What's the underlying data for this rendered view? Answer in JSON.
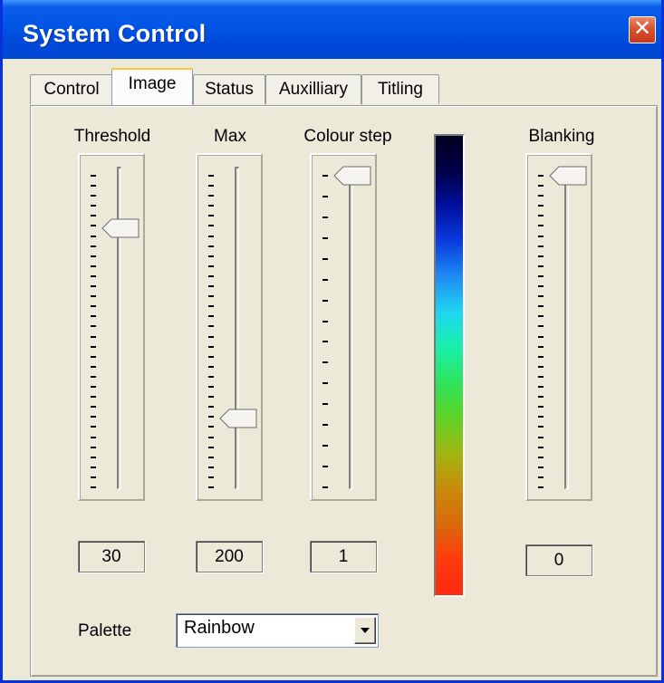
{
  "window": {
    "title": "System Control",
    "close_glyph": "✕"
  },
  "tabs": [
    {
      "label": "Control",
      "active": false
    },
    {
      "label": "Image",
      "active": true
    },
    {
      "label": "Status",
      "active": false
    },
    {
      "label": "Auxilliary",
      "active": false
    },
    {
      "label": "Titling",
      "active": false
    }
  ],
  "sliders": {
    "threshold": {
      "label": "Threshold",
      "value": "30",
      "tick_count": 32,
      "thumb_fraction": 0.17
    },
    "max": {
      "label": "Max",
      "value": "200",
      "tick_count": 32,
      "thumb_fraction": 0.78
    },
    "colour_step": {
      "label": "Colour step",
      "value": "1",
      "tick_count": 16,
      "thumb_fraction": 0.0
    },
    "blanking": {
      "label": "Blanking",
      "value": "0",
      "tick_count": 32,
      "thumb_fraction": 0.0
    }
  },
  "colorbar": {
    "name": "rainbow-colorbar",
    "stops": [
      "#000020",
      "#000048",
      "#0010a0",
      "#0a3ce0",
      "#1f8df4",
      "#1fd6f0",
      "#19f0a8",
      "#2fe35a",
      "#5fd224",
      "#a3b513",
      "#c88a0b",
      "#d96a0b",
      "#ff3a0d",
      "#ff2a10"
    ]
  },
  "palette": {
    "label": "Palette",
    "value": "Rainbow",
    "arrow_glyph": "▼"
  },
  "colors": {
    "titlebar": "#0055e5",
    "dialog_bg": "#ece9d8",
    "tab_highlight": "#ffc83c"
  }
}
